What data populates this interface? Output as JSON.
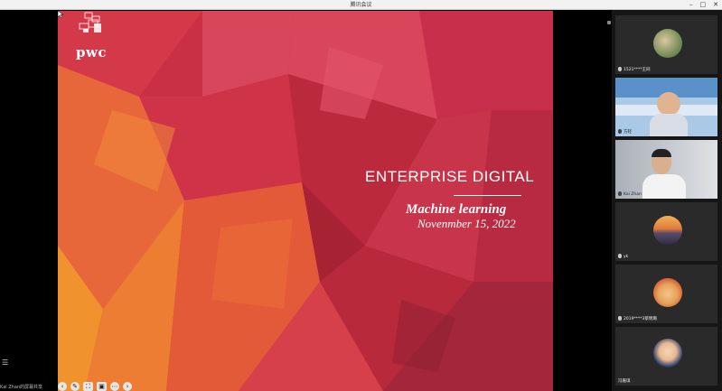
{
  "window": {
    "title": "腾讯会议",
    "controls": [
      "–",
      "□",
      "✕"
    ]
  },
  "slide": {
    "logo_text": "pwc",
    "title": "ENTERPRISE DIGITAL",
    "subtitle": "Machine learning",
    "date": "Novenmber 15, 2022"
  },
  "toolbar": {
    "buttons": [
      "‹",
      "✎",
      "⛶",
      "▣",
      "⋯",
      "›"
    ]
  },
  "bottom_left_text": "Kai Zhan的屏幕共享",
  "participants": [
    {
      "name": "1521****王同",
      "avatar": "flowers"
    },
    {
      "name": "方轻",
      "avatar": "camera-man-glasses"
    },
    {
      "name": "Kai Zhan",
      "avatar": "camera-man-room"
    },
    {
      "name": "yk",
      "avatar": "sunset-silhouette"
    },
    {
      "name": "2019****3蔡明璐",
      "avatar": "cartoon-dog"
    },
    {
      "name": "冯嘉琪",
      "avatar": "anime-character"
    }
  ],
  "colors": {
    "slide_accent_red": "#c4243a",
    "slide_accent_orange": "#e87a2e",
    "panel_bg": "#161616"
  }
}
